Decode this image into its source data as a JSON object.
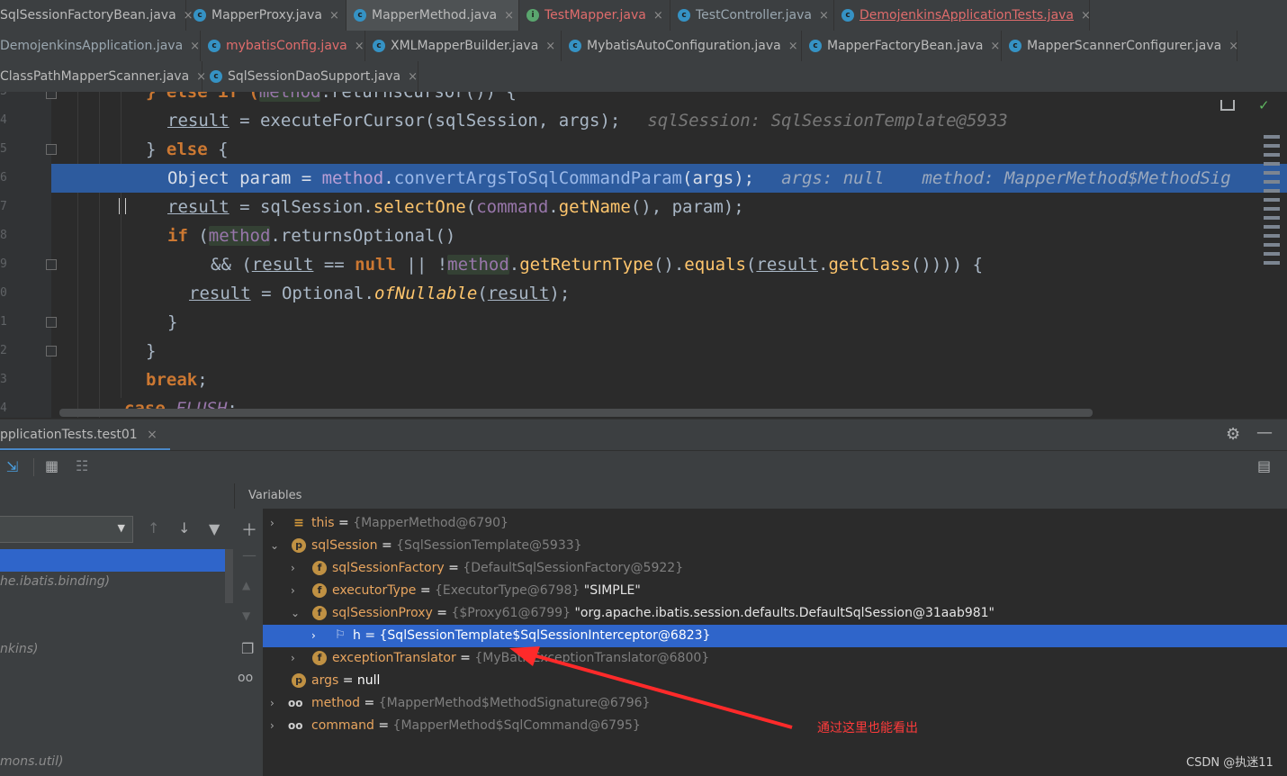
{
  "tabs": {
    "row1": [
      {
        "label": "SqlSessionFactoryBean.java"
      },
      {
        "label": "MapperProxy.java"
      },
      {
        "label": "MapperMethod.java"
      },
      {
        "label": "TestMapper.java"
      },
      {
        "label": "TestController.java"
      },
      {
        "label": "DemojenkinsApplicationTests.java"
      }
    ],
    "row2": [
      {
        "label": "DemojenkinsApplication.java"
      },
      {
        "label": "mybatisConfig.java"
      },
      {
        "label": "XMLMapperBuilder.java"
      },
      {
        "label": "MybatisAutoConfiguration.java"
      },
      {
        "label": "MapperFactoryBean.java"
      },
      {
        "label": "MapperScannerConfigurer.java"
      }
    ],
    "row3": [
      {
        "label": "ClassPathMapperScanner.java"
      },
      {
        "label": "SqlSessionDaoSupport.java"
      }
    ],
    "close_glyph": "×"
  },
  "editor": {
    "line_numbers": [
      "3",
      "4",
      "5",
      "6",
      "7",
      "8",
      "9",
      "0",
      "1",
      "2",
      "3",
      "4"
    ],
    "code": {
      "l0_kw1": "} else if (",
      "l0_sel": "method",
      "l0_rest": ".returnsCursor()) {",
      "l1_a": "result",
      "l1_b": " = ",
      "l1_c": "executeForCursor",
      "l1_d": "(sqlSession, args);",
      "l1_hint": "sqlSession: SqlSessionTemplate@5933",
      "l2_a": "} ",
      "l2_b": "else",
      "l2_c": " {",
      "l3_a": "Object param",
      "l3_b": " = ",
      "l3_c": "method",
      "l3_d": ".",
      "l3_e": "convertArgsToSqlCommandParam",
      "l3_f": "(args);",
      "l3_hint1": "args: null",
      "l3_hint2": "method: MapperMethod$MethodSig",
      "l4_a": "result",
      "l4_b": " = sqlSession.",
      "l4_c": "selectOne",
      "l4_d": "(",
      "l4_e": "command",
      "l4_f": ".",
      "l4_g": "getName",
      "l4_h": "(), param);",
      "l5_a": "if",
      "l5_b": " (",
      "l5_c": "method",
      "l5_d": ".returnsOptional()",
      "l6_a": "&& (",
      "l6_b": "result",
      "l6_c": " == ",
      "l6_d": "null",
      "l6_e": " || !",
      "l6_f": "method",
      "l6_g": ".",
      "l6_h": "getReturnType",
      "l6_i": "().",
      "l6_j": "equals",
      "l6_k": "(",
      "l6_l": "result",
      "l6_m": ".",
      "l6_n": "getClass",
      "l6_o": "()))) {",
      "l7_a": "result",
      "l7_b": " = ",
      "l7_c": "Optional",
      "l7_d": ".",
      "l7_e": "ofNullable",
      "l7_f": "(",
      "l7_g": "result",
      "l7_h": ");",
      "l8": "}",
      "l9": "}",
      "l10_a": "break",
      "l10_b": ";",
      "l11_a": "case ",
      "l11_b": "FLUSH",
      "l11_c": ":"
    }
  },
  "debug": {
    "session_tab": "pplicationTests.test01",
    "variables_title": "Variables",
    "frames": [
      {
        "text": "he.ibatis.binding)"
      },
      {
        "text": "nkins)"
      },
      {
        "text": "mons.util)"
      }
    ],
    "variables": [
      {
        "name": "this",
        "eq": " = ",
        "value": "{MapperMethod@6790}",
        "extra": ""
      },
      {
        "name": "sqlSession",
        "eq": " = ",
        "value": "{SqlSessionTemplate@5933}",
        "extra": ""
      },
      {
        "name": "sqlSessionFactory",
        "eq": " = ",
        "value": "{DefaultSqlSessionFactory@5922}",
        "extra": ""
      },
      {
        "name": "executorType",
        "eq": " = ",
        "value": "{ExecutorType@6798}",
        "extra": " \"SIMPLE\""
      },
      {
        "name": "sqlSessionProxy",
        "eq": " = ",
        "value": "{$Proxy61@6799}",
        "extra": " \"org.apache.ibatis.session.defaults.DefaultSqlSession@31aab981\""
      },
      {
        "name": "h",
        "eq": " = ",
        "value": "{SqlSessionTemplate$SqlSessionInterceptor@6823}",
        "extra": ""
      },
      {
        "name": "exceptionTranslator",
        "eq": " = ",
        "value": "{MyBatisExceptionTranslator@6800}",
        "extra": ""
      },
      {
        "name": "args",
        "eq": " = ",
        "value": "null",
        "extra": ""
      },
      {
        "name": "method",
        "eq": " = ",
        "value": "{MapperMethod$MethodSignature@6796}",
        "extra": ""
      },
      {
        "name": "command",
        "eq": " = ",
        "value": "{MapperMethod$SqlCommand@6795}",
        "extra": ""
      }
    ],
    "icon_letters": {
      "p": "p",
      "f": "f"
    }
  },
  "annotation": "通过这里也能看出",
  "watermark": "CSDN @执迷11",
  "colors": {
    "selection": "#2f65ca",
    "exec_line": "#2d5b9e",
    "arrow": "#ff2a2a",
    "keyword": "#cc7832",
    "method": "#ffc66d"
  }
}
